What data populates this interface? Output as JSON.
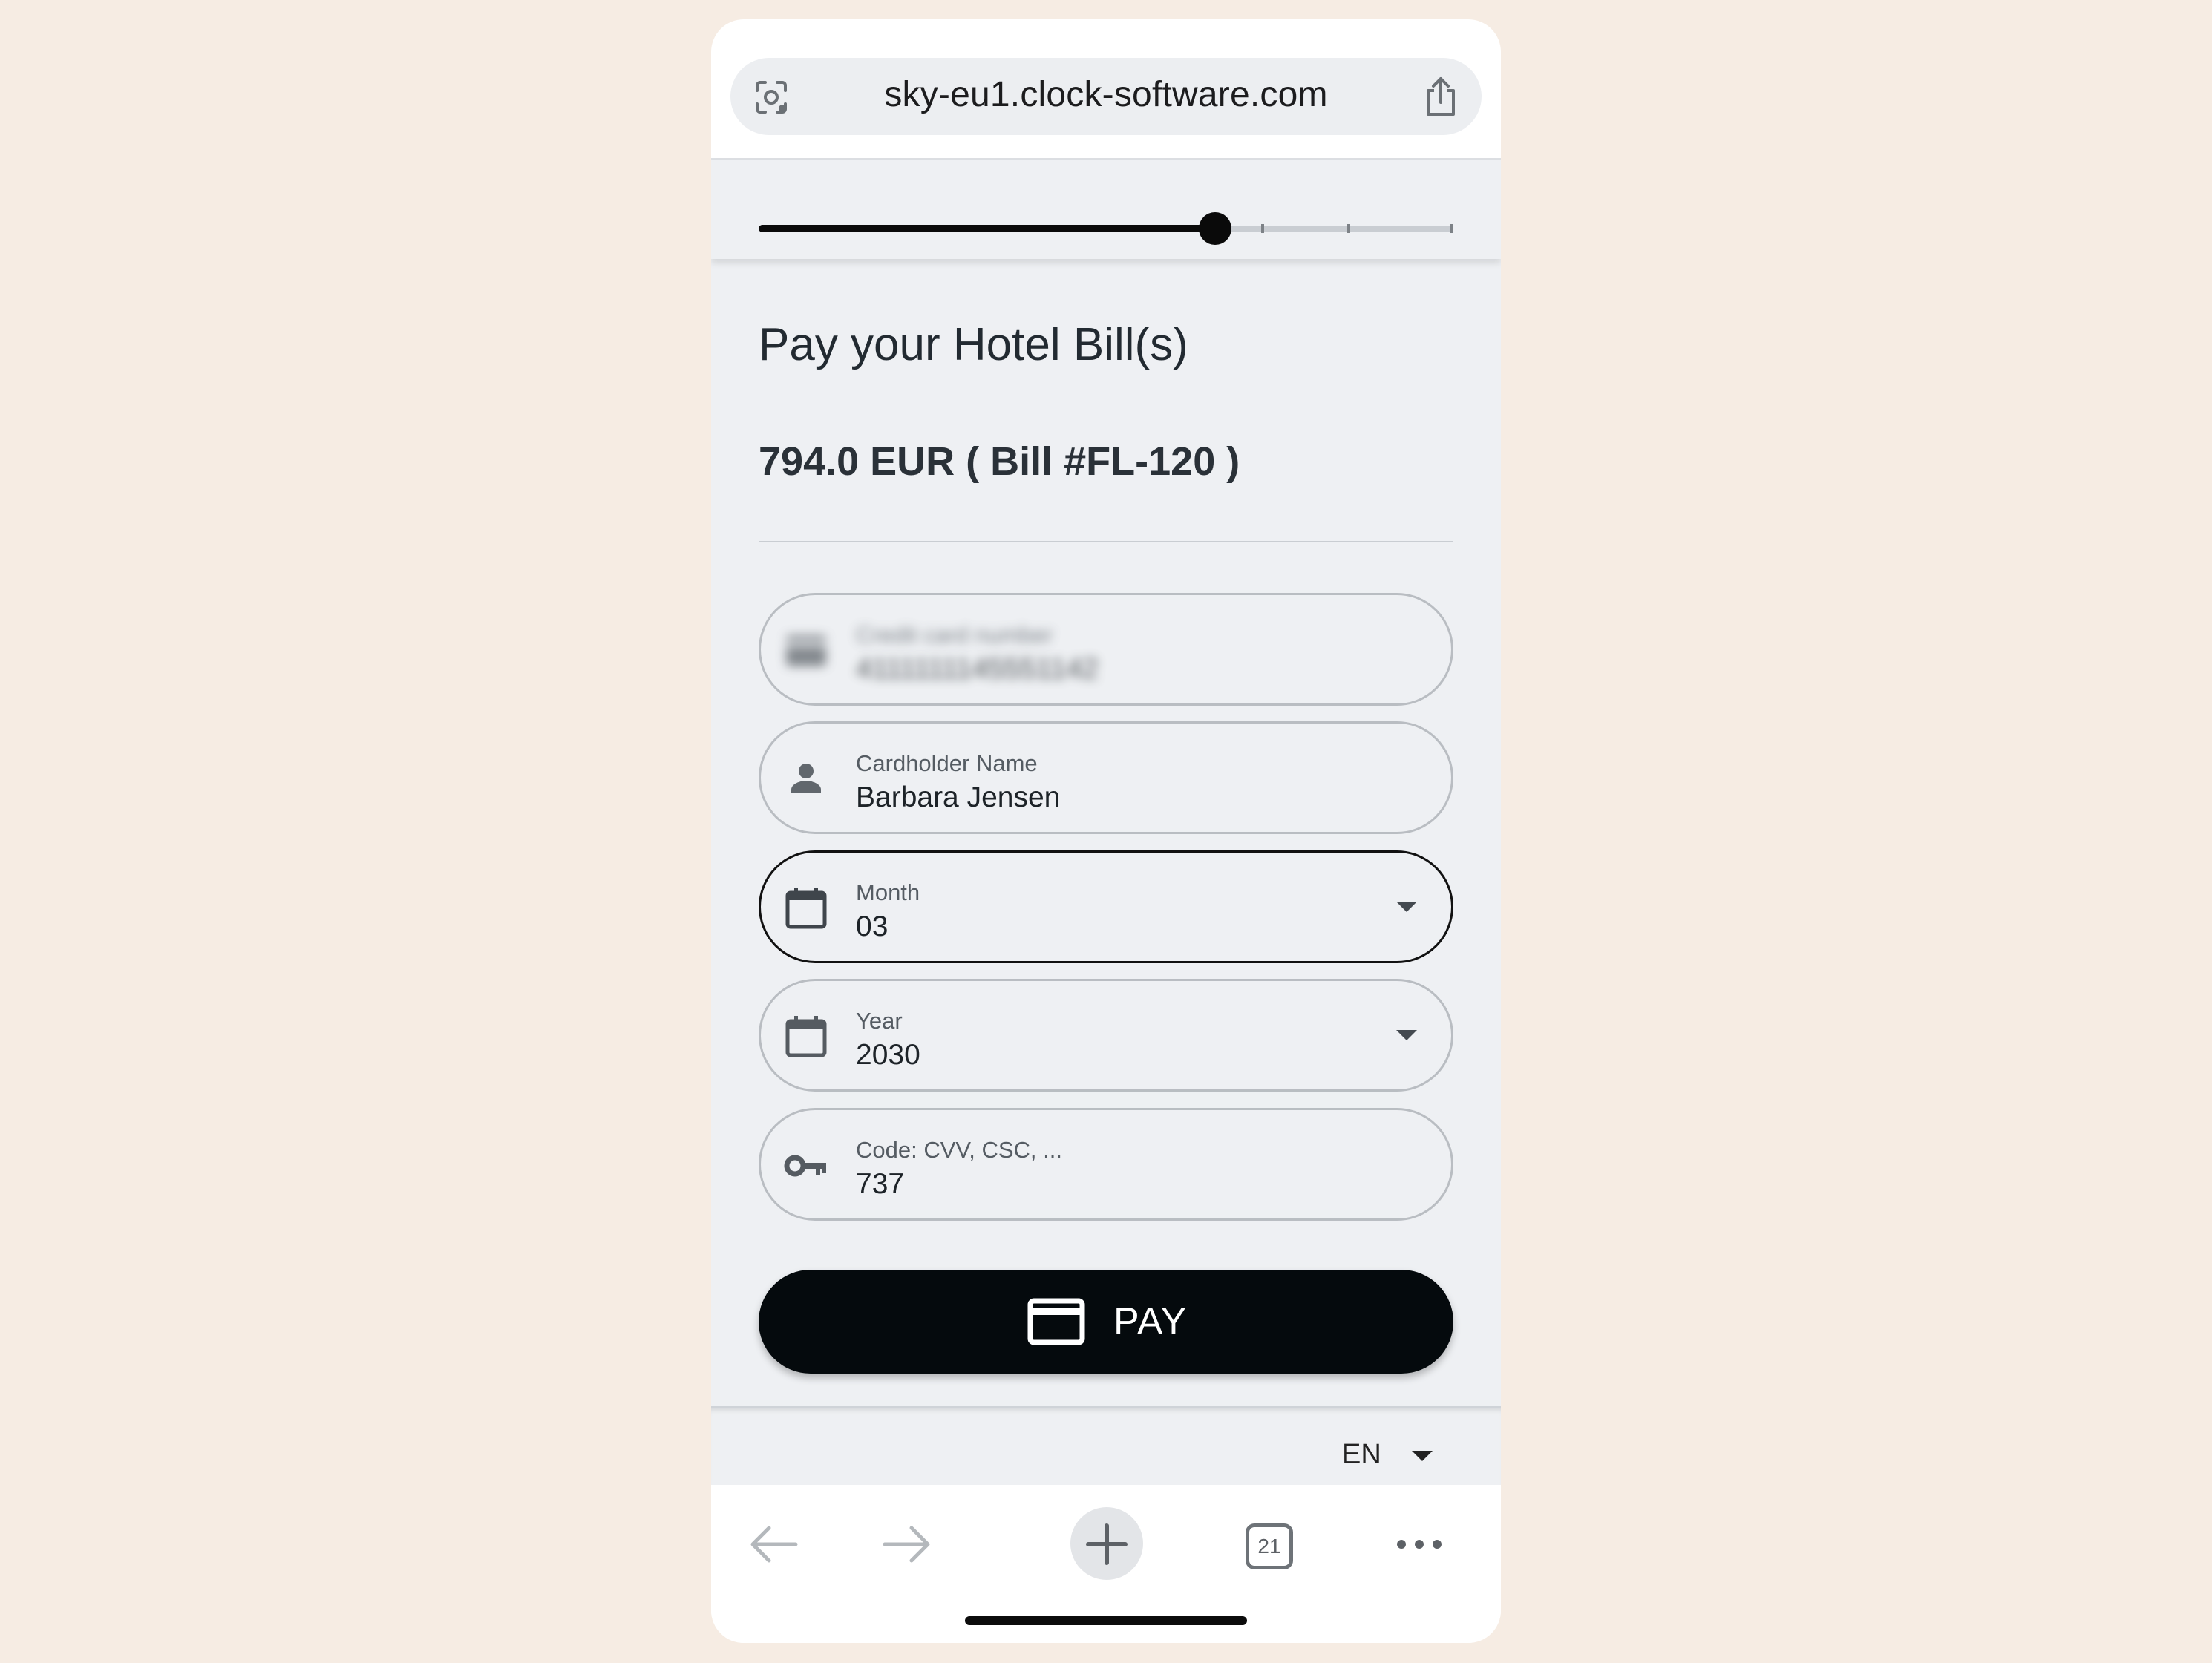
{
  "browser": {
    "url": "sky-eu1.clock-software.com",
    "tabs_count": "21"
  },
  "progress": {
    "value": 0.6566,
    "steps_total": 4
  },
  "page": {
    "title": "Pay your Hotel Bill(s)",
    "amount_line": "794.0 EUR ( Bill #FL-120 )"
  },
  "form": {
    "card_number": {
      "label": "Credit card number",
      "value": "4111111145551142"
    },
    "cardholder": {
      "label": "Cardholder Name",
      "value": "Barbara Jensen"
    },
    "month": {
      "label": "Month",
      "value": "03"
    },
    "year": {
      "label": "Year",
      "value": "2030"
    },
    "code": {
      "label": "Code: CVV, CSC, ...",
      "value": "737"
    }
  },
  "pay_button": {
    "label": "PAY"
  },
  "footer": {
    "language": "EN"
  },
  "colors": {
    "background": "#f6ece3",
    "page": "#eef0f3",
    "button": "#050a0d",
    "focused_border": "#111111"
  }
}
